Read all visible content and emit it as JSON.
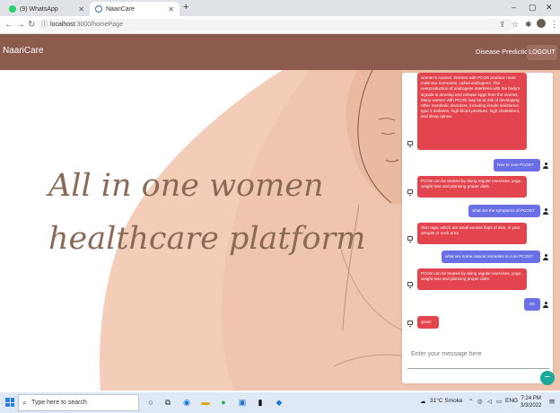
{
  "browser": {
    "tabs": [
      {
        "title": "(9) WhatsApp",
        "active": false,
        "icon": "whatsapp-icon"
      },
      {
        "title": "NaariCare",
        "active": true,
        "icon": "naaricare-icon"
      }
    ],
    "new_tab_symbol": "+",
    "url_host": "localhost",
    "url_rest": ":3000/homePage",
    "window_controls": [
      "–",
      "▢",
      "✕"
    ]
  },
  "nav": {
    "brand": "NaariCare",
    "disease_prediction": "Disease Prediction",
    "logout": "LOGOUT"
  },
  "hero": {
    "line1": "All in one women",
    "line2": "healthcare platform"
  },
  "chat": {
    "messages": [
      {
        "from": "bot",
        "text": "women's ovaries. Women with PCOS produce more male sex hormones, called androgens. The overproduction of androgens interferes with the body's signals to develop and release eggs from the ovaries. Many women with PCOS may be at risk of developing other metabolic disorders, including insulin resistance, type 2 diabetes, high blood pressure, high cholesterol, and sleep apnea."
      },
      {
        "from": "user",
        "text": "how to cure PCOS?"
      },
      {
        "from": "bot",
        "text": "PCOS can be treated by doing regular exercises, yoga , weight loss and planning proper diets."
      },
      {
        "from": "user",
        "text": "what are the symptoms of PCOS?"
      },
      {
        "from": "bot",
        "text": "Skin tags, which are small excess flaps of skin, in your armpits or neck area"
      },
      {
        "from": "user",
        "text": "what are some natural remedies to cure PCOS?"
      },
      {
        "from": "bot",
        "text": "PCOS can be treated by doing regular exercises, yoga , weight loss and planning proper diets."
      },
      {
        "from": "user",
        "text": "OK"
      },
      {
        "from": "bot",
        "text": "great!"
      }
    ],
    "input_placeholder": "Enter your message here",
    "fab_symbol": "−"
  },
  "taskbar": {
    "search_placeholder": "Type here to search",
    "weather": "31°C Smoke",
    "language": "ENG",
    "time": "7:24 PM",
    "date": "3/3/2022"
  },
  "colors": {
    "nav_bg": "#8b5b4e",
    "bot_bubble": "#e2454d",
    "user_bubble": "#6b6fe5",
    "hero_text": "#8a6a56",
    "hero_peach": "#f3cdb8"
  }
}
